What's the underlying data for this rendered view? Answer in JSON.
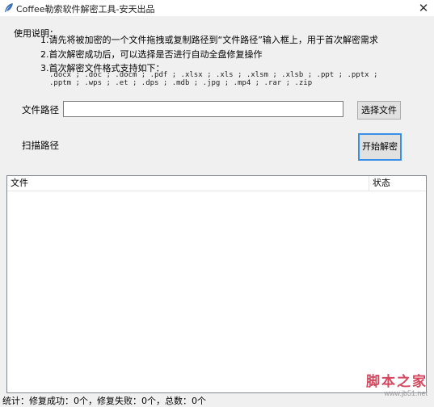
{
  "window": {
    "title": "Coffee勒索软件解密工具-安天出品",
    "close_glyph": "✕",
    "app_icon": "feather-icon"
  },
  "instructions": {
    "title": "使用说明：",
    "line1": "1.请先将被加密的一个文件拖拽或复制路径到“文件路径”输入框上，用于首次解密需求",
    "line2": "2.首次解密成功后，可以选择是否进行自动全盘修复操作",
    "line3": "3.首次解密文件格式支持如下：",
    "formats1": ".docx ; .doc ; .docm ; .pdf ; .xlsx ; .xls ; .xlsm ; .xlsb ; .ppt ; .pptx ;",
    "formats2": ".pptm ; .wps ; .et ; .dps ; .mdb ; .jpg ; .mp4 ; .rar ; .zip"
  },
  "form": {
    "path_label": "文件路径",
    "path_value": "",
    "select_button": "选择文件",
    "scan_label": "扫描路径",
    "start_button": "开始解密"
  },
  "list": {
    "col_file": "文件",
    "col_status": "状态"
  },
  "status": "统计：修复成功：0个，修复失败：0个，总数：0个",
  "watermark": {
    "main": "脚本之家",
    "sub": "www.jb51.net"
  }
}
